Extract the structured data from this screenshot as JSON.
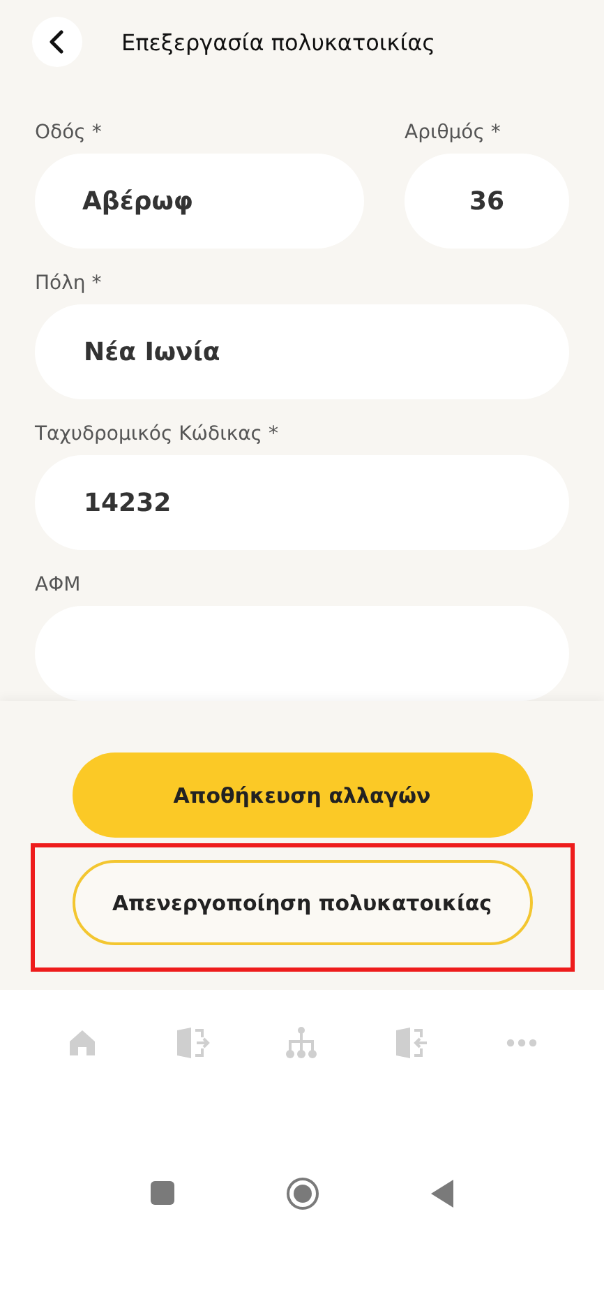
{
  "header": {
    "title": "Επεξεργασία πολυκατοικίας"
  },
  "fields": [
    {
      "label": "Οδός *",
      "value": "Αβέρωφ",
      "kind": "wide"
    },
    {
      "label": "Αριθμός *",
      "value": "36",
      "kind": "narrow"
    },
    {
      "label": "Πόλη *",
      "value": "Νέα Ιωνία",
      "kind": "full"
    },
    {
      "label": "Ταχυδρομικός Κώδικας *",
      "value": "14232",
      "kind": "full"
    },
    {
      "label": "ΑΦΜ",
      "kind": "full"
    }
  ],
  "actions": [
    {
      "label": "Αποθήκευση αλλαγών",
      "kind": "primary",
      "highlighted": false
    },
    {
      "label": "Απενεργοποίηση πολυκατοικίας",
      "kind": "outline",
      "highlighted": true
    }
  ],
  "bottom_nav": [
    {
      "kind": "home"
    },
    {
      "kind": "exit"
    },
    {
      "kind": "tree"
    },
    {
      "kind": "enter"
    },
    {
      "kind": "more"
    }
  ]
}
